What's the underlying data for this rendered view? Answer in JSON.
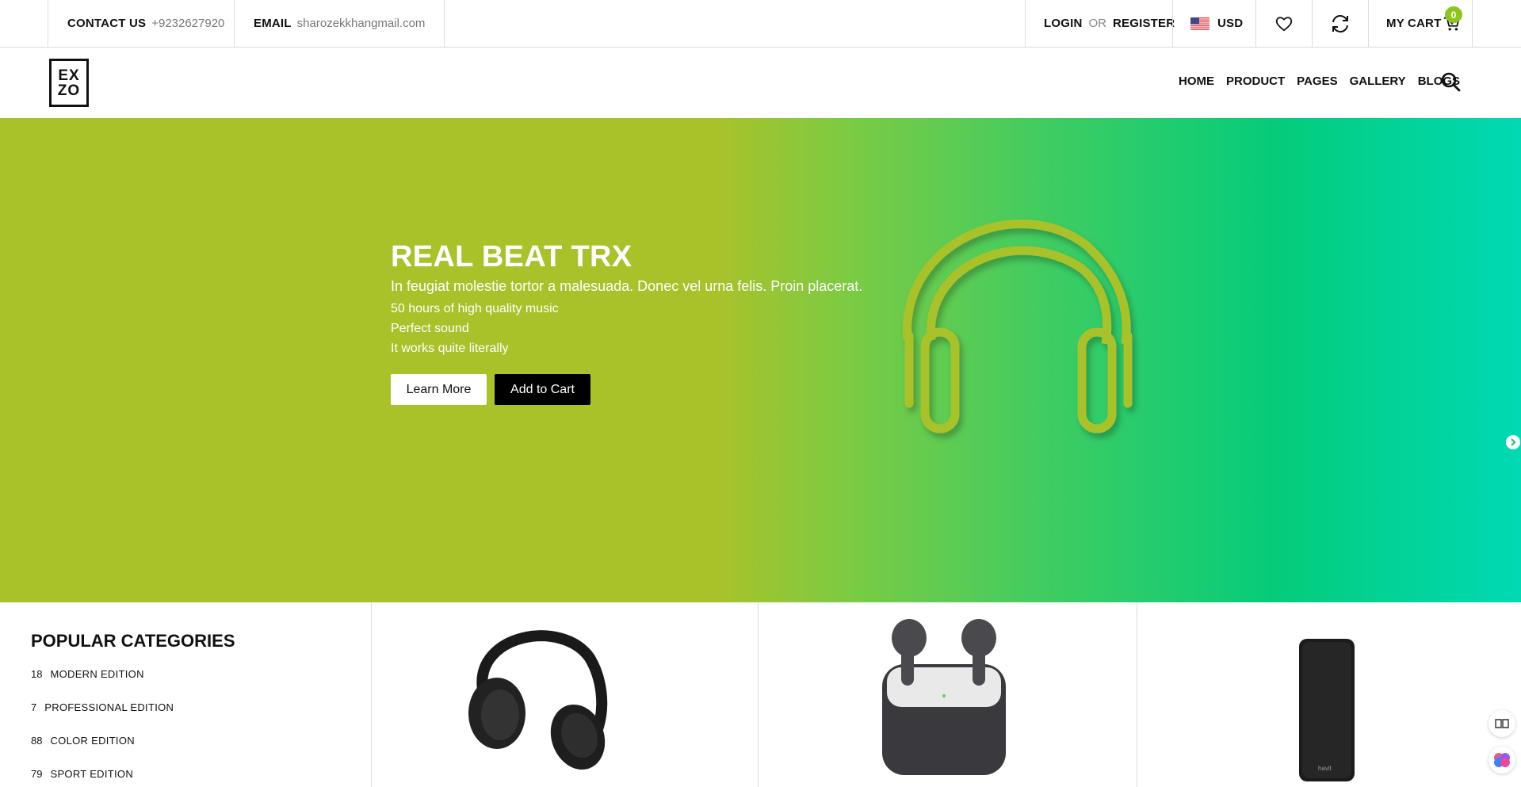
{
  "topbar": {
    "contact_label": "CONTACT US",
    "contact_value": "+9232627920",
    "email_label": "EMAIL",
    "email_value": "sharozekkhangmail.com",
    "login": "LOGIN",
    "or": "OR",
    "register": "REGISTER",
    "currency": "USD",
    "cart_label": "MY CART",
    "cart_count": "0"
  },
  "header": {
    "logo_line1": "EX",
    "logo_line2": "ZO",
    "nav": [
      "HOME",
      "PRODUCT",
      "PAGES",
      "GALLERY",
      "BLOGS"
    ]
  },
  "hero": {
    "title": "REAL BEAT TRX",
    "subtitle": "In feugiat molestie tortor a malesuada. Donec vel urna felis. Proin placerat.",
    "features": [
      "50 hours of high quality music",
      "Perfect sound",
      "It works quite literally"
    ],
    "learn_more": "Learn More",
    "add_to_cart": "Add to Cart"
  },
  "categories": {
    "title": "POPULAR CATEGORIES",
    "items": [
      {
        "count": "18",
        "name": "MODERN EDITION"
      },
      {
        "count": "7",
        "name": "PROFESSIONAL EDITION"
      },
      {
        "count": "88",
        "name": "COLOR EDITION"
      },
      {
        "count": "79",
        "name": "SPORT EDITION"
      }
    ]
  },
  "products": {
    "powerbank_brand": "havit"
  },
  "colors": {
    "accent": "#8fc41f",
    "hero_left": "#a9c22a",
    "hero_right": "#00d9b4"
  },
  "icons": {
    "wishlist": "heart-icon",
    "sync": "refresh-icon",
    "cart": "cart-icon",
    "search": "search-icon",
    "next": "chevron-right-icon"
  }
}
